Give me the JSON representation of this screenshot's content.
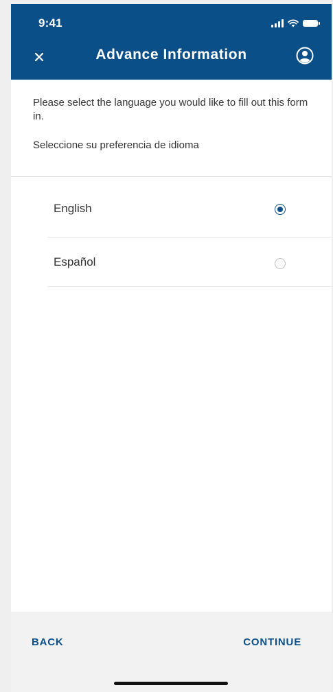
{
  "status_bar": {
    "time": "9:41"
  },
  "header": {
    "title": "Advance Information",
    "close_icon": "close-icon",
    "profile_icon": "user-circle-icon"
  },
  "instructions": {
    "english": "Please select the language you would like to fill out this form in.",
    "spanish": "Seleccione su preferencia de idioma"
  },
  "language_options": [
    {
      "label": "English",
      "selected": true
    },
    {
      "label": "Español",
      "selected": false
    }
  ],
  "footer": {
    "back_label": "BACK",
    "continue_label": "CONTINUE"
  },
  "colors": {
    "brand": "#0b4f88",
    "text": "#333333",
    "footer_bg": "#f2f2f2"
  }
}
